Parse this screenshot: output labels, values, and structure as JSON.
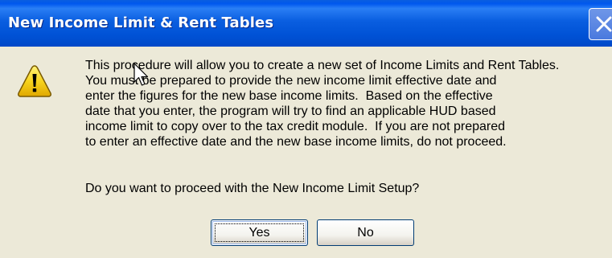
{
  "dialog": {
    "title": "New Income Limit & Rent Tables",
    "message": "This procedure will allow you to create a new set of Income Limits and Rent Tables.\nYou must be prepared to provide the new income limit effective date and\nenter the figures for the new base income limits.  Based on the effective\ndate that you enter, the program will try to find an applicable HUD based\nincome limit to copy over to the tax credit module.  If you are not prepared\nto enter an effective date and the new base income limits, do not proceed.",
    "question": "Do you want to proceed with the New Income Limit Setup?",
    "buttons": {
      "yes_label": "Yes",
      "no_label": "No"
    },
    "icon": "warning-icon"
  },
  "colors": {
    "titlebar": "#0a5ee0",
    "dialog_bg": "#ece9d8",
    "warning_yellow": "#f7d31e"
  }
}
